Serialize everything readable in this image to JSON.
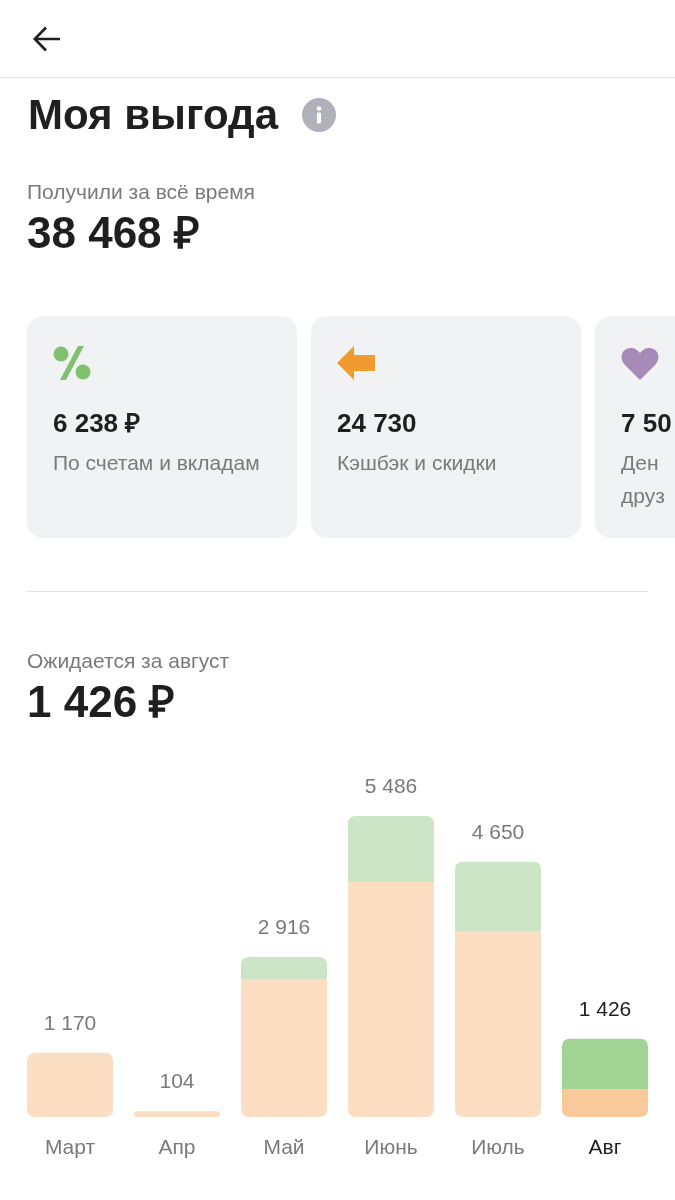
{
  "page": {
    "title": "Моя выгода"
  },
  "total": {
    "label": "Получили за всё время",
    "amount": "38 468 ₽"
  },
  "cards": [
    {
      "kind": "percent",
      "value": "6 238 ₽",
      "description": "По счетам и вкладам"
    },
    {
      "kind": "arrow",
      "value": "24 730",
      "description": "Кэшбэк и скидки"
    },
    {
      "kind": "heart",
      "value": "7 50",
      "description": "Ден друз"
    }
  ],
  "forecast": {
    "label": "Ожидается за август",
    "amount": "1 426 ₽"
  },
  "chart": {
    "bars": [
      {
        "selected": false
      },
      {
        "selected": false
      },
      {
        "selected": false
      },
      {
        "selected": false
      },
      {
        "selected": false
      },
      {
        "selected": true
      }
    ],
    "chart_data": {
      "type": "bar",
      "categories": [
        "Март",
        "Апр",
        "Май",
        "Июнь",
        "Июль",
        "Авг"
      ],
      "values": [
        1170,
        104,
        2916,
        5486,
        4650,
        1426
      ],
      "value_labels": [
        "1 170",
        "104",
        "2 916",
        "5 486",
        "4 650",
        "1 426"
      ]
    }
  }
}
